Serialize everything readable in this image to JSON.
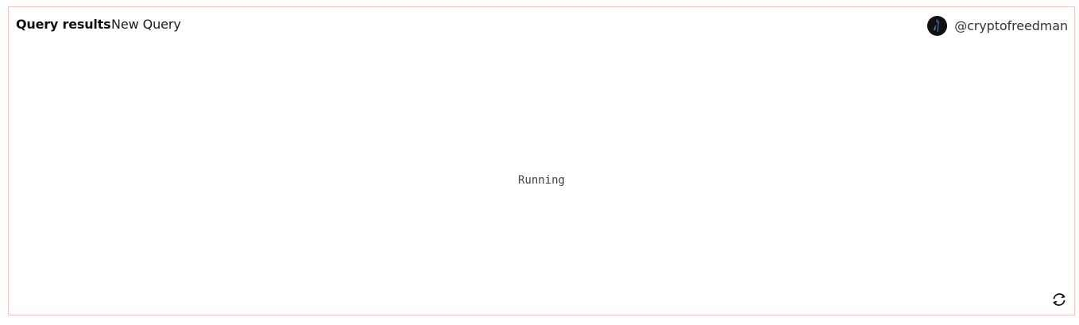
{
  "header": {
    "title": "Query results",
    "subtitle": "New Query"
  },
  "user": {
    "username": "@cryptofreedman",
    "avatar_icon": "user-avatar"
  },
  "main": {
    "status_text": "Running"
  },
  "controls": {
    "refresh_icon": "refresh-icon"
  },
  "colors": {
    "border": "#f1c7c0",
    "text": "#111111",
    "muted_text": "#444444"
  }
}
